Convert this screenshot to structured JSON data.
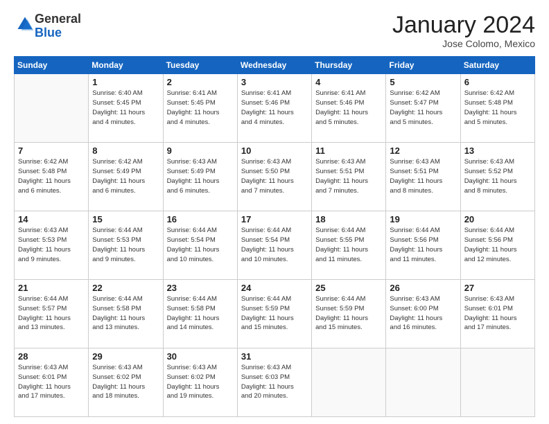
{
  "header": {
    "logo_general": "General",
    "logo_blue": "Blue",
    "month_title": "January 2024",
    "location": "Jose Colomo, Mexico"
  },
  "weekdays": [
    "Sunday",
    "Monday",
    "Tuesday",
    "Wednesday",
    "Thursday",
    "Friday",
    "Saturday"
  ],
  "weeks": [
    [
      {
        "day": "",
        "info": ""
      },
      {
        "day": "1",
        "info": "Sunrise: 6:40 AM\nSunset: 5:45 PM\nDaylight: 11 hours\nand 4 minutes."
      },
      {
        "day": "2",
        "info": "Sunrise: 6:41 AM\nSunset: 5:45 PM\nDaylight: 11 hours\nand 4 minutes."
      },
      {
        "day": "3",
        "info": "Sunrise: 6:41 AM\nSunset: 5:46 PM\nDaylight: 11 hours\nand 4 minutes."
      },
      {
        "day": "4",
        "info": "Sunrise: 6:41 AM\nSunset: 5:46 PM\nDaylight: 11 hours\nand 5 minutes."
      },
      {
        "day": "5",
        "info": "Sunrise: 6:42 AM\nSunset: 5:47 PM\nDaylight: 11 hours\nand 5 minutes."
      },
      {
        "day": "6",
        "info": "Sunrise: 6:42 AM\nSunset: 5:48 PM\nDaylight: 11 hours\nand 5 minutes."
      }
    ],
    [
      {
        "day": "7",
        "info": "Sunrise: 6:42 AM\nSunset: 5:48 PM\nDaylight: 11 hours\nand 6 minutes."
      },
      {
        "day": "8",
        "info": "Sunrise: 6:42 AM\nSunset: 5:49 PM\nDaylight: 11 hours\nand 6 minutes."
      },
      {
        "day": "9",
        "info": "Sunrise: 6:43 AM\nSunset: 5:49 PM\nDaylight: 11 hours\nand 6 minutes."
      },
      {
        "day": "10",
        "info": "Sunrise: 6:43 AM\nSunset: 5:50 PM\nDaylight: 11 hours\nand 7 minutes."
      },
      {
        "day": "11",
        "info": "Sunrise: 6:43 AM\nSunset: 5:51 PM\nDaylight: 11 hours\nand 7 minutes."
      },
      {
        "day": "12",
        "info": "Sunrise: 6:43 AM\nSunset: 5:51 PM\nDaylight: 11 hours\nand 8 minutes."
      },
      {
        "day": "13",
        "info": "Sunrise: 6:43 AM\nSunset: 5:52 PM\nDaylight: 11 hours\nand 8 minutes."
      }
    ],
    [
      {
        "day": "14",
        "info": "Sunrise: 6:43 AM\nSunset: 5:53 PM\nDaylight: 11 hours\nand 9 minutes."
      },
      {
        "day": "15",
        "info": "Sunrise: 6:44 AM\nSunset: 5:53 PM\nDaylight: 11 hours\nand 9 minutes."
      },
      {
        "day": "16",
        "info": "Sunrise: 6:44 AM\nSunset: 5:54 PM\nDaylight: 11 hours\nand 10 minutes."
      },
      {
        "day": "17",
        "info": "Sunrise: 6:44 AM\nSunset: 5:54 PM\nDaylight: 11 hours\nand 10 minutes."
      },
      {
        "day": "18",
        "info": "Sunrise: 6:44 AM\nSunset: 5:55 PM\nDaylight: 11 hours\nand 11 minutes."
      },
      {
        "day": "19",
        "info": "Sunrise: 6:44 AM\nSunset: 5:56 PM\nDaylight: 11 hours\nand 11 minutes."
      },
      {
        "day": "20",
        "info": "Sunrise: 6:44 AM\nSunset: 5:56 PM\nDaylight: 11 hours\nand 12 minutes."
      }
    ],
    [
      {
        "day": "21",
        "info": "Sunrise: 6:44 AM\nSunset: 5:57 PM\nDaylight: 11 hours\nand 13 minutes."
      },
      {
        "day": "22",
        "info": "Sunrise: 6:44 AM\nSunset: 5:58 PM\nDaylight: 11 hours\nand 13 minutes."
      },
      {
        "day": "23",
        "info": "Sunrise: 6:44 AM\nSunset: 5:58 PM\nDaylight: 11 hours\nand 14 minutes."
      },
      {
        "day": "24",
        "info": "Sunrise: 6:44 AM\nSunset: 5:59 PM\nDaylight: 11 hours\nand 15 minutes."
      },
      {
        "day": "25",
        "info": "Sunrise: 6:44 AM\nSunset: 5:59 PM\nDaylight: 11 hours\nand 15 minutes."
      },
      {
        "day": "26",
        "info": "Sunrise: 6:43 AM\nSunset: 6:00 PM\nDaylight: 11 hours\nand 16 minutes."
      },
      {
        "day": "27",
        "info": "Sunrise: 6:43 AM\nSunset: 6:01 PM\nDaylight: 11 hours\nand 17 minutes."
      }
    ],
    [
      {
        "day": "28",
        "info": "Sunrise: 6:43 AM\nSunset: 6:01 PM\nDaylight: 11 hours\nand 17 minutes."
      },
      {
        "day": "29",
        "info": "Sunrise: 6:43 AM\nSunset: 6:02 PM\nDaylight: 11 hours\nand 18 minutes."
      },
      {
        "day": "30",
        "info": "Sunrise: 6:43 AM\nSunset: 6:02 PM\nDaylight: 11 hours\nand 19 minutes."
      },
      {
        "day": "31",
        "info": "Sunrise: 6:43 AM\nSunset: 6:03 PM\nDaylight: 11 hours\nand 20 minutes."
      },
      {
        "day": "",
        "info": ""
      },
      {
        "day": "",
        "info": ""
      },
      {
        "day": "",
        "info": ""
      }
    ]
  ]
}
